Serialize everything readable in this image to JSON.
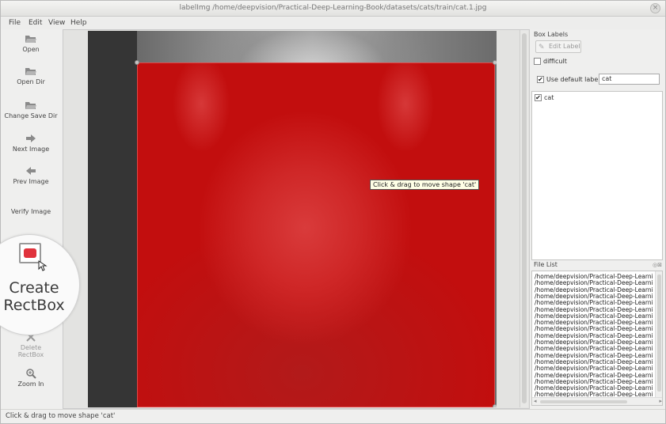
{
  "window": {
    "title": "labelImg /home/deepvision/Practical-Deep-Learning-Book/datasets/cats/train/cat.1.jpg",
    "close_glyph": "×"
  },
  "menu": [
    "File",
    "Edit",
    "View",
    "Help"
  ],
  "toolbar": {
    "open": "Open",
    "open_dir": "Open Dir",
    "change_save_dir": "Change Save Dir",
    "next_image": "Next Image",
    "prev_image": "Prev Image",
    "verify_image": "Verify Image",
    "create_rectbox_line1": "Create",
    "create_rectbox_line2": "RectBox",
    "delete_rectbox_line1": "Delete",
    "delete_rectbox_line2": "RectBox",
    "zoom_in": "Zoom In"
  },
  "canvas": {
    "tooltip": "Click & drag to move shape 'cat'",
    "shape_color": "#c20e0e"
  },
  "box_labels": {
    "title": "Box Labels",
    "edit_label": "Edit Label",
    "difficult_label": "difficult",
    "difficult_checked": false,
    "use_default_label": "Use default label",
    "use_default_checked": true,
    "default_label_value": "cat",
    "labels": [
      {
        "name": "cat",
        "checked": true
      }
    ]
  },
  "file_list": {
    "title": "File List",
    "items": [
      "/home/deepvision/Practical-Deep-Learning",
      "/home/deepvision/Practical-Deep-Learning",
      "/home/deepvision/Practical-Deep-Learning",
      "/home/deepvision/Practical-Deep-Learning",
      "/home/deepvision/Practical-Deep-Learning",
      "/home/deepvision/Practical-Deep-Learning",
      "/home/deepvision/Practical-Deep-Learning",
      "/home/deepvision/Practical-Deep-Learning",
      "/home/deepvision/Practical-Deep-Learning",
      "/home/deepvision/Practical-Deep-Learning",
      "/home/deepvision/Practical-Deep-Learning",
      "/home/deepvision/Practical-Deep-Learning",
      "/home/deepvision/Practical-Deep-Learning",
      "/home/deepvision/Practical-Deep-Learning",
      "/home/deepvision/Practical-Deep-Learning",
      "/home/deepvision/Practical-Deep-Learning",
      "/home/deepvision/Practical-Deep-Learning",
      "/home/deepvision/Practical-Deep-Learning",
      "/home/deepvision/Practical-Deep-Learning"
    ]
  },
  "status": "Click & drag to move shape 'cat'"
}
